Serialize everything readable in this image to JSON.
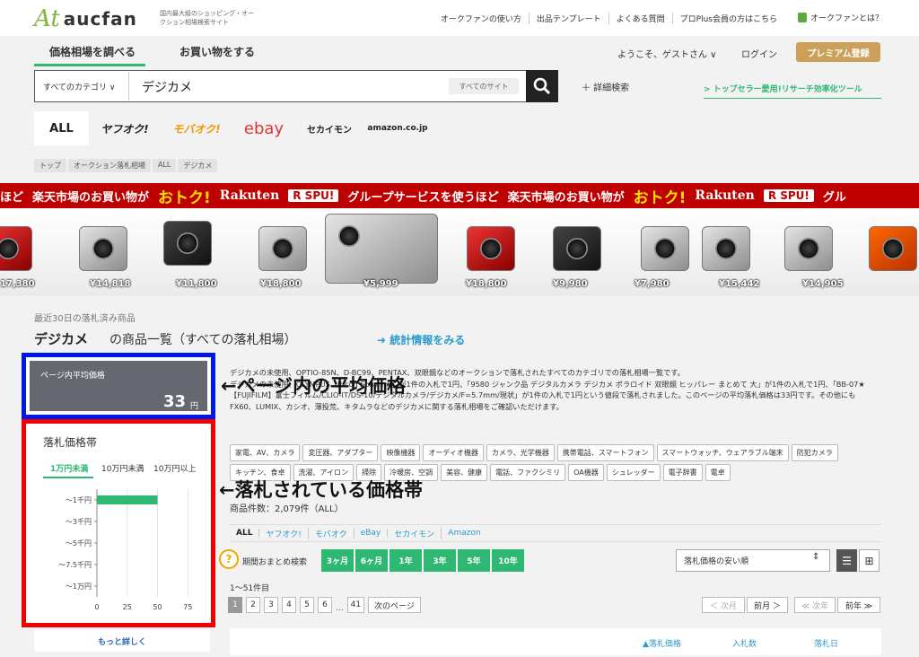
{
  "header": {
    "logo_mark": "At",
    "logo_text": "aucfan",
    "tagline": "国内最大級のショッピング・オークション相場検索サイト",
    "links": [
      "オークファンの使い方",
      "出品テンプレート",
      "よくある質問",
      "プロPlus会員の方はこちら"
    ],
    "about": "オークファンとは？"
  },
  "nav": {
    "tab_price": "価格相場を調べる",
    "tab_shop": "お買い物をする",
    "welcome": "ようこそ、ゲストさん ∨",
    "login": "ログイン",
    "premium": "プレミアム登録"
  },
  "search": {
    "category": "すべてのカテゴリ ∨",
    "query": "デジカメ",
    "site": "すべてのサイト",
    "detail": "＋ 詳細検索",
    "topseller": "> トップセラー愛用!リサーチ効率化ツール"
  },
  "sites": [
    "ALL",
    "ヤフオク!",
    "モバオク!",
    "ebay",
    "セカイモン",
    "amazon.co.jp"
  ],
  "breadcrumbs": [
    "トップ",
    "オークション落札相場",
    "ALL",
    "デジカメ"
  ],
  "banner": {
    "pre": "ほど",
    "text1": "楽天市場のお買い物が",
    "otoku": "おトク!",
    "rakuten": "Rakuten",
    "spu": "R SPU!",
    "text2": "グループサービスを使うほど",
    "text3": "楽天市場のお買い物が",
    "otoku2": "おトク!",
    "rakuten2": "Rakuten",
    "spu2": "R SPU!",
    "tail": "グル",
    "prices": [
      "17,380",
      "¥14,818",
      "¥11,800",
      "¥18,800",
      "¥5,999",
      "¥18,800",
      "¥9,980",
      "¥7,980",
      "¥15,442",
      "¥14,905"
    ]
  },
  "main": {
    "recent": "最近30日の落札済み商品",
    "title": "デジカメ",
    "title_sub": "の商品一覧（すべての落札相場）",
    "stats_link": "➜ 統計情報をみる"
  },
  "avg": {
    "label": "ページ内平均価格",
    "value": "33",
    "unit": "円"
  },
  "band": {
    "title": "落札価格帯",
    "tabs": [
      "1万円未満",
      "10万円未満",
      "10万円以上"
    ],
    "chart_data": {
      "type": "bar",
      "orientation": "horizontal",
      "categories": [
        "～1千円",
        "～3千円",
        "～5千円",
        "～7.5千円",
        "～1万円"
      ],
      "values": [
        50,
        0,
        0,
        0,
        0
      ],
      "xticks": [
        "0",
        "25",
        "50",
        "75"
      ],
      "xlim": [
        0,
        80
      ],
      "color": "#2eb872"
    },
    "more": "もっと詳しく"
  },
  "description": "デジカメの未使用、OLYMPUS、Ricoh Sony☆★」が1件の入札で1円、「9580 ジャンク品 デジタルカメラ デジカメ ポラロイド 双眼鏡 ヒッパレー まとめて 大」が1件の入札で1円、「BB-07★【FUJIFILM】富士フィルム/CLIO-IT/DS-10/デジタルカメラ/デジカメ/F=5.7mm/現状」が1件の入札で1円という値段で落札されました。このページの平均落札価格は33円です。その他にもFX60、LUMIX、カシオ、薄投荒、キタムラなどのデジカメに関する落札相場をご確認いただけます。",
  "desc_head": "デジカメの未使用、OPTIO-85N、D-BC99、PENTAX、双眼鏡などのオークションで落札されたすべてのカテゴリでの落札相場一覧です。",
  "tags": [
    "家電、AV、カメラ",
    "変圧器、アダプター",
    "映像機器",
    "オーディオ機器",
    "カメラ、光学機器",
    "携帯電話、スマートフォン",
    "スマートウォッチ、ウェアラブル端末",
    "防犯カメラ",
    "キッチン、食卓",
    "洗濯、アイロン",
    "掃除",
    "冷暖房、空調",
    "美容、健康",
    "電話、ファクシミリ",
    "OA機器",
    "シュレッダー",
    "電子辞書",
    "電卓"
  ],
  "annotations": {
    "avg": "←ページ内の平均価格",
    "band": "←落札されている価格帯"
  },
  "results": {
    "count": "商品件数：2,079件（ALL）",
    "site_filters": [
      "ALL",
      "ヤフオク!",
      "モバオク",
      "eBay",
      "セカイモン",
      "Amazon"
    ],
    "period_label": "期間おまとめ検索",
    "periods": [
      "3ヶ月",
      "6ヶ月",
      "1年",
      "3年",
      "5年",
      "10年"
    ],
    "sort": "落札価格の安い順",
    "range": "1～51件目",
    "pages": [
      "1",
      "2",
      "3",
      "4",
      "5",
      "6",
      "41"
    ],
    "dots": "...",
    "next_page": "次のページ",
    "prev_month": "＜ 次月",
    "prev_month2": "前月 ＞",
    "prev_year": "≪ 次年",
    "prev_year2": "前年 ≫",
    "columns": [
      "▲落札価格",
      "入札数",
      "落札日"
    ]
  }
}
